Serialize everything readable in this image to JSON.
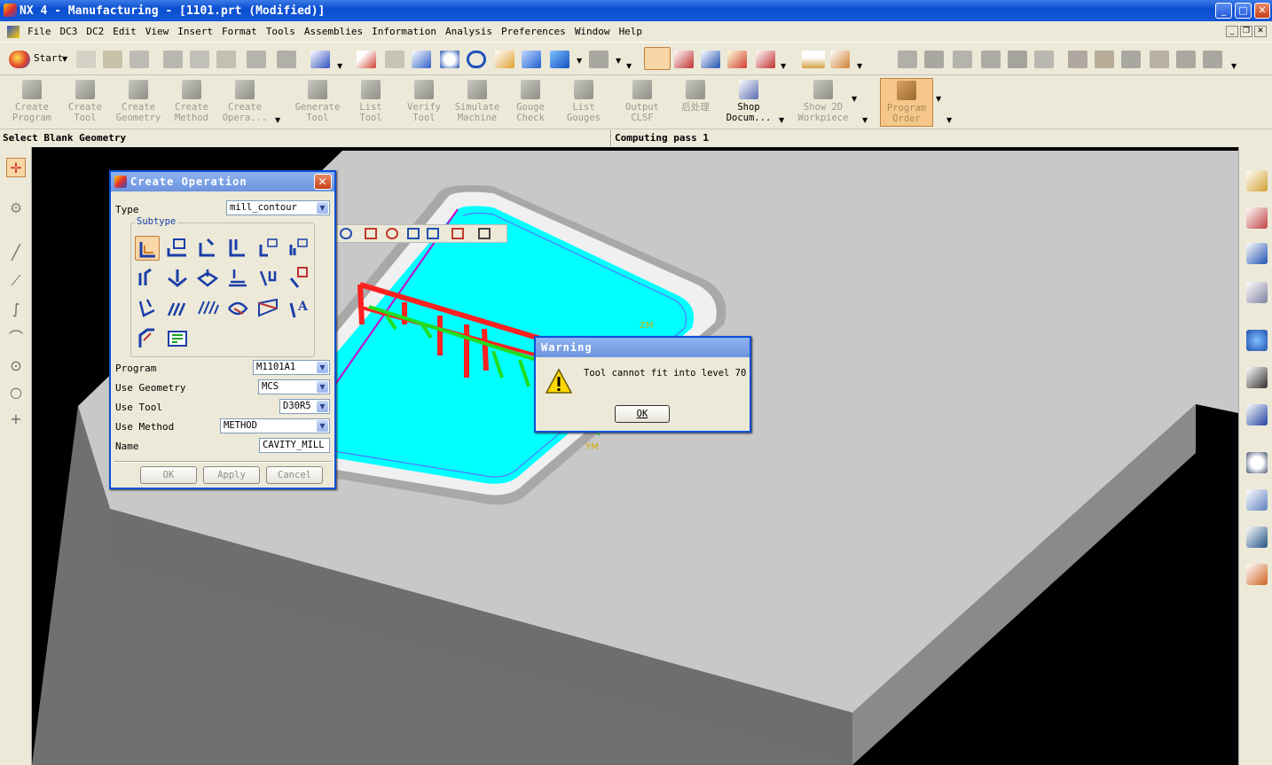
{
  "window": {
    "title": "NX 4 - Manufacturing - [1101.prt (Modified)]",
    "min": "_",
    "max": "□",
    "close": "✕"
  },
  "menu": [
    "File",
    "DC3",
    "DC2",
    "Edit",
    "View",
    "Insert",
    "Format",
    "Tools",
    "Assemblies",
    "Information",
    "Analysis",
    "Preferences",
    "Window",
    "Help"
  ],
  "toolbar": {
    "start_label": "Start"
  },
  "big_buttons": [
    {
      "l1": "Create",
      "l2": "Program"
    },
    {
      "l1": "Create",
      "l2": "Tool"
    },
    {
      "l1": "Create",
      "l2": "Geometry"
    },
    {
      "l1": "Create",
      "l2": "Method"
    },
    {
      "l1": "Create",
      "l2": "Opera..."
    },
    {
      "l1": "Generate",
      "l2": "Tool"
    },
    {
      "l1": "List",
      "l2": "Tool"
    },
    {
      "l1": "Verify",
      "l2": "Tool"
    },
    {
      "l1": "Simulate",
      "l2": "Machine"
    },
    {
      "l1": "Gouge",
      "l2": "Check"
    },
    {
      "l1": "List",
      "l2": "Gouges"
    },
    {
      "l1": "Output",
      "l2": "CLSF"
    },
    {
      "l1": "后处理",
      "l2": ""
    },
    {
      "l1": "Shop",
      "l2": "Docum..."
    },
    {
      "l1": "Show 2D",
      "l2": "Workpiece"
    },
    {
      "l1": "Program",
      "l2": "Order"
    }
  ],
  "status": {
    "left": "Select Blank Geometry",
    "right": "Computing pass 1"
  },
  "axes": {
    "zm": "ZM",
    "ym": "YM"
  },
  "create_op": {
    "title": "Create Operation",
    "type_label": "Type",
    "type_value": "mill_contour",
    "subtype_label": "Subtype",
    "program_label": "Program",
    "program_value": "M1101A1",
    "geometry_label": "Use Geometry",
    "geometry_value": "MCS",
    "tool_label": "Use Tool",
    "tool_value": "D30R5",
    "method_label": "Use Method",
    "method_value": "METHOD",
    "name_label": "Name",
    "name_value": "CAVITY_MILL",
    "ok": "OK",
    "apply": "Apply",
    "cancel": "Cancel"
  },
  "warning": {
    "title": "Warning",
    "message": "Tool cannot fit into level 70",
    "ok": "OK"
  }
}
